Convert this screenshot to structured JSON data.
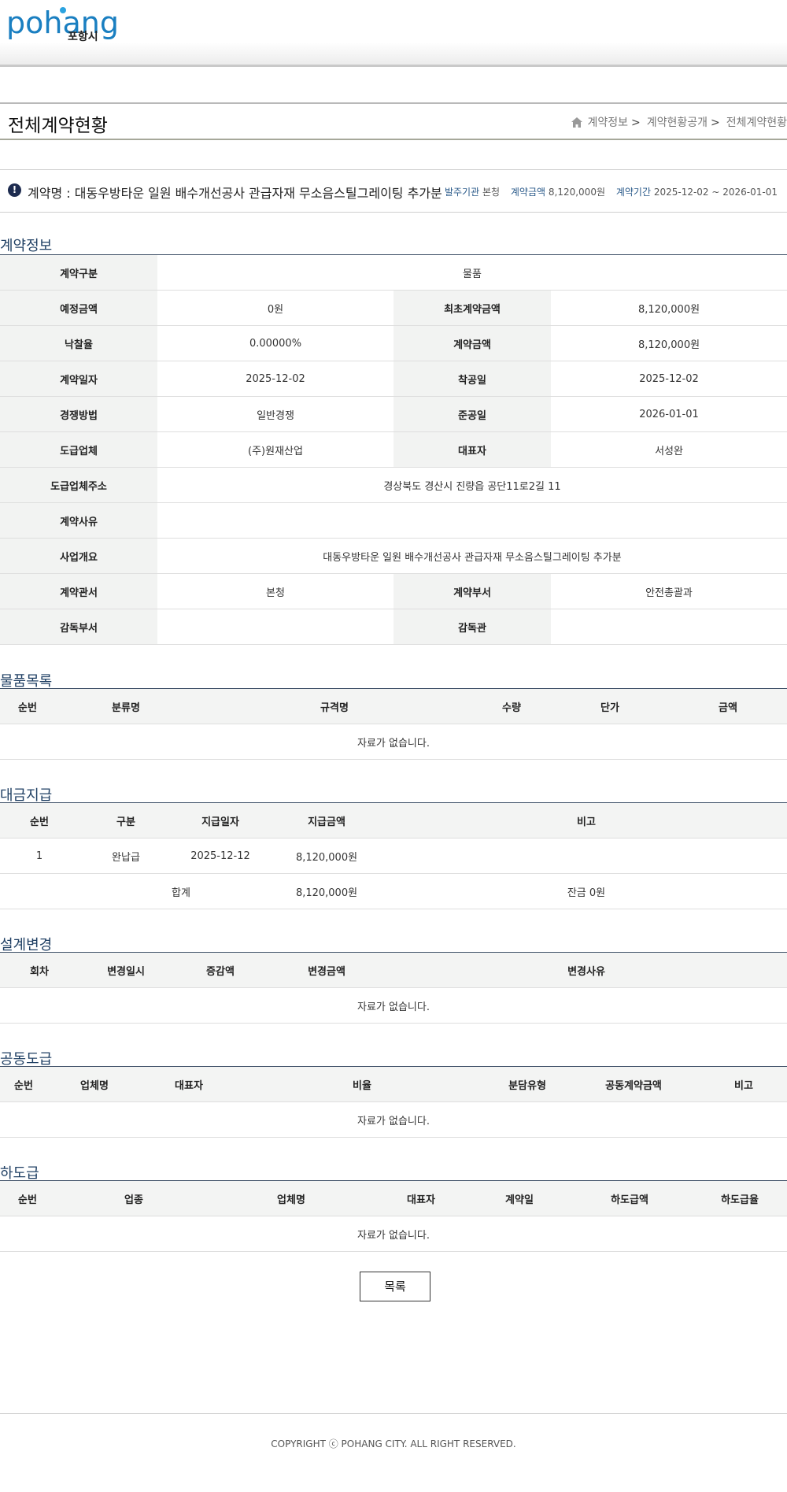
{
  "header": {
    "logo_text": "pohang",
    "logo_kor": "포항시"
  },
  "page": {
    "title": "전체계약현황",
    "breadcrumb": [
      "계약정보",
      "계약현황공개",
      "전체계약현황"
    ]
  },
  "summary": {
    "contract_name": "계약명 : 대동우방타운 일원 배수개선공사 관급자재 무소음스틸그레이팅 추가분",
    "agency_label": "발주기관",
    "agency_value": "본청",
    "amount_label": "계약금액",
    "amount_value": "8,120,000원",
    "period_label": "계약기간",
    "period_value": "2025-12-02 ~ 2026-01-01"
  },
  "contract_info": {
    "section_title": "계약정보",
    "type_label": "계약구분",
    "type_value": "물품",
    "est_label": "예정금액",
    "est_value": "0원",
    "init_label": "최초계약금액",
    "init_value": "8,120,000원",
    "rate_label": "낙찰율",
    "rate_value": "0.00000%",
    "amt_label": "계약금액",
    "amt_value": "8,120,000원",
    "date_label": "계약일자",
    "date_value": "2025-12-02",
    "start_label": "착공일",
    "start_value": "2025-12-02",
    "method_label": "경쟁방법",
    "method_value": "일반경쟁",
    "end_label": "준공일",
    "end_value": "2026-01-01",
    "vendor_label": "도급업체",
    "vendor_value": "(주)원재산업",
    "rep_label": "대표자",
    "rep_value": "서성완",
    "addr_label": "도급업체주소",
    "addr_value": "경상북도 경산시 진량읍 공단11로2길 11",
    "reason_label": "계약사유",
    "reason_value": "",
    "overview_label": "사업개요",
    "overview_value": "대동우방타운 일원 배수개선공사 관급자재 무소음스틸그레이팅 추가분",
    "office_label": "계약관서",
    "office_value": "본청",
    "dept_label": "계약부서",
    "dept_value": "안전총괄과",
    "sup_dept_label": "감독부서",
    "sup_dept_value": "",
    "supervisor_label": "감독관",
    "supervisor_value": ""
  },
  "goods": {
    "section_title": "물품목록",
    "headers": [
      "순번",
      "분류명",
      "규격명",
      "수량",
      "단가",
      "금액"
    ],
    "empty": "자료가 없습니다."
  },
  "payment": {
    "section_title": "대금지급",
    "headers": [
      "순번",
      "구분",
      "지급일자",
      "지급금액",
      "비고"
    ],
    "rows": [
      {
        "no": "1",
        "type": "완납급",
        "date": "2025-12-12",
        "amount": "8,120,000원",
        "note": ""
      }
    ],
    "total_label": "합계",
    "total_amount": "8,120,000원",
    "balance": "잔금 0원"
  },
  "design_change": {
    "section_title": "설계변경",
    "headers": [
      "회차",
      "변경일시",
      "증감액",
      "변경금액",
      "변경사유"
    ],
    "empty": "자료가 없습니다."
  },
  "joint": {
    "section_title": "공동도급",
    "headers": [
      "순번",
      "업체명",
      "대표자",
      "비율",
      "분담유형",
      "공동계약금액",
      "비고"
    ],
    "empty": "자료가 없습니다."
  },
  "subcontract": {
    "section_title": "하도급",
    "headers": [
      "순번",
      "업종",
      "업체명",
      "대표자",
      "계약일",
      "하도급액",
      "하도급율"
    ],
    "empty": "자료가 없습니다."
  },
  "buttons": {
    "list": "목록"
  },
  "footer": {
    "copyright": "COPYRIGHT ⓒ POHANG CITY. ALL RIGHT RESERVED."
  }
}
